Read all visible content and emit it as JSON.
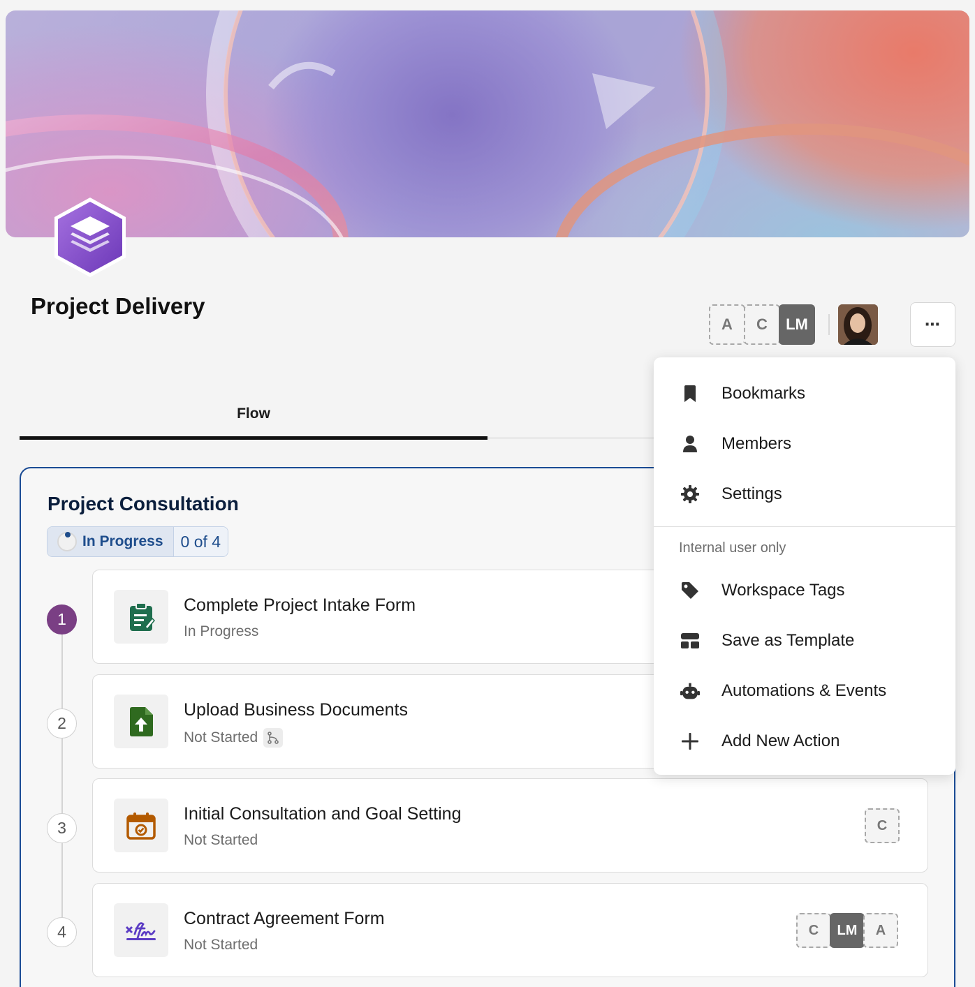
{
  "page": {
    "title": "Project Delivery",
    "more_label": "⋯"
  },
  "header_assignees": [
    "A",
    "C",
    "LM"
  ],
  "tabs": [
    {
      "label": "Flow",
      "active": true
    }
  ],
  "stage": {
    "title": "Project Consultation",
    "status": "In Progress",
    "progress": "0 of 4"
  },
  "tasks": [
    {
      "number": "1",
      "title": "Complete Project Intake Form",
      "status": "In Progress",
      "icon": "clipboard-form-icon",
      "assignees": []
    },
    {
      "number": "2",
      "title": "Upload Business Documents",
      "status": "Not Started",
      "icon": "file-upload-icon",
      "assignees": []
    },
    {
      "number": "3",
      "title": "Initial Consultation and Goal Setting",
      "status": "Not Started",
      "icon": "calendar-check-icon",
      "assignees": [
        "C"
      ]
    },
    {
      "number": "4",
      "title": "Contract Agreement Form",
      "status": "Not Started",
      "icon": "signature-icon",
      "assignees": [
        "C",
        "LM",
        "A"
      ]
    }
  ],
  "menu": {
    "items": [
      {
        "label": "Bookmarks",
        "icon": "bookmark-icon"
      },
      {
        "label": "Members",
        "icon": "person-icon"
      },
      {
        "label": "Settings",
        "icon": "gear-icon"
      }
    ],
    "section_label": "Internal user only",
    "internal_items": [
      {
        "label": "Workspace Tags",
        "icon": "tag-icon"
      },
      {
        "label": "Save as Template",
        "icon": "template-icon"
      },
      {
        "label": "Automations & Events",
        "icon": "robot-icon"
      },
      {
        "label": "Add New Action",
        "icon": "plus-icon"
      }
    ]
  },
  "colors": {
    "accent_blue": "#1a4b94",
    "step_active": "#7a3f84",
    "task1_icon": "#1f6e4e",
    "task2_icon": "#2f6a1f",
    "task3_icon": "#b35a00",
    "task4_icon": "#5b3cc4"
  }
}
